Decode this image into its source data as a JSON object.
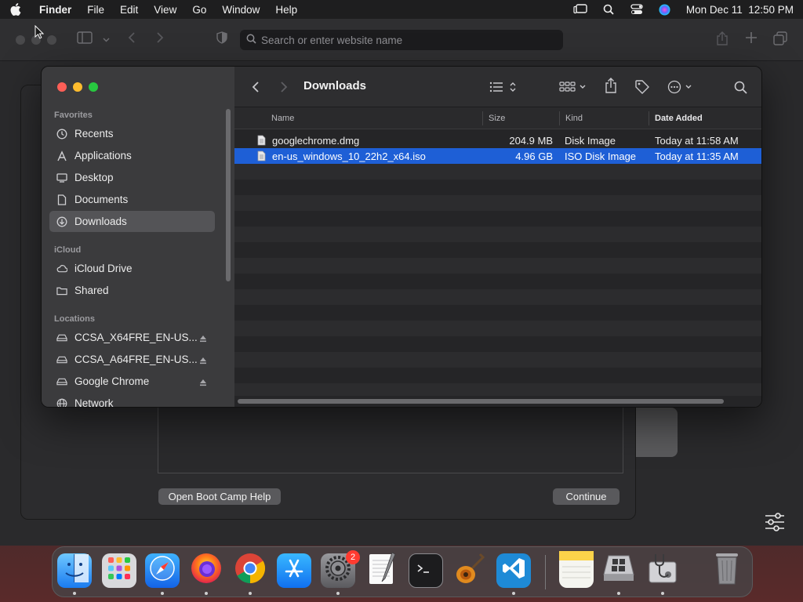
{
  "menubar": {
    "app_name": "Finder",
    "items": [
      "File",
      "Edit",
      "View",
      "Go",
      "Window",
      "Help"
    ],
    "datetime": "Mon Dec 11  12:50 PM"
  },
  "safari": {
    "address_placeholder": "Search or enter website name"
  },
  "bootcamp": {
    "help_button": "Open Boot Camp Help",
    "continue_button": "Continue"
  },
  "finder": {
    "title": "Downloads",
    "sidebar": {
      "favorites_label": "Favorites",
      "favorites": [
        "Recents",
        "Applications",
        "Desktop",
        "Documents",
        "Downloads"
      ],
      "icloud_label": "iCloud",
      "icloud": [
        "iCloud Drive",
        "Shared"
      ],
      "locations_label": "Locations",
      "locations": [
        "CCSA_X64FRE_EN-US...",
        "CCSA_A64FRE_EN-US...",
        "Google Chrome",
        "Network"
      ]
    },
    "columns": {
      "name": "Name",
      "size": "Size",
      "kind": "Kind",
      "date_added": "Date Added"
    },
    "files": [
      {
        "name": "googlechrome.dmg",
        "size": "204.9 MB",
        "kind": "Disk Image",
        "date_added": "Today at 11:58 AM"
      },
      {
        "name": "en-us_windows_10_22h2_x64.iso",
        "size": "4.96 GB",
        "kind": "ISO Disk Image",
        "date_added": "Today at 11:35 AM"
      }
    ]
  },
  "dock": {
    "settings_badge": "2"
  },
  "colors": {
    "selection": "#1e5fd6",
    "close": "#fe5f57",
    "minimize": "#febc2e",
    "zoom": "#28c840"
  }
}
